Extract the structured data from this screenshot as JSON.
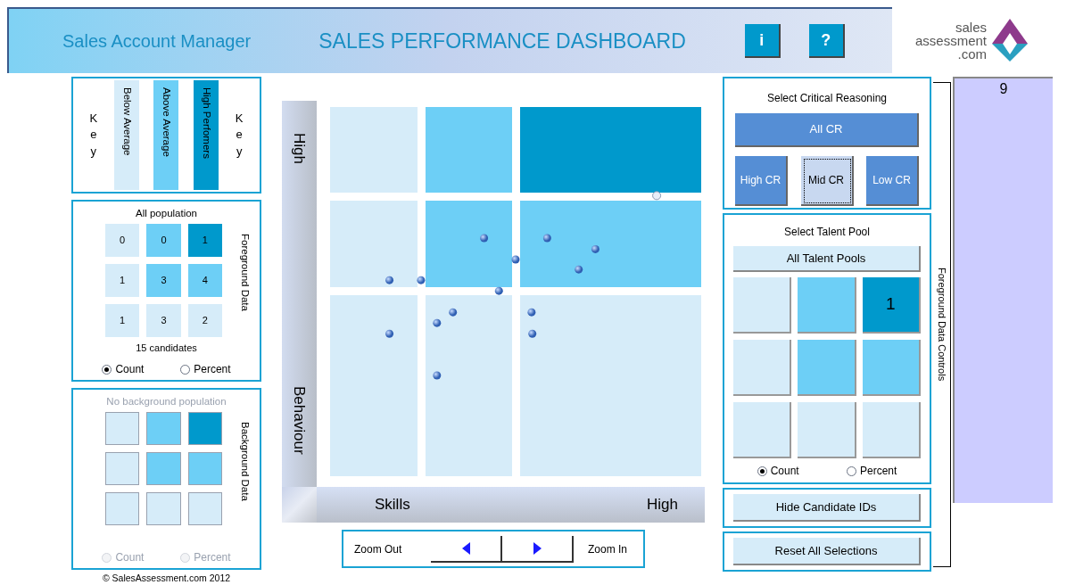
{
  "header": {
    "title": "Sales Account Manager",
    "dashboard_title": "SALES PERFORMANCE DASHBOARD",
    "buttons": [
      "i",
      "?"
    ],
    "logo": [
      "sales",
      "assessment",
      ".com"
    ]
  },
  "key": {
    "side_labels": [
      "Key",
      "Key"
    ],
    "items": [
      {
        "label": "Below Average",
        "color": "#d6ecf9"
      },
      {
        "label": "Above Average",
        "color": "#6dcff6"
      },
      {
        "label": "High Perfomers",
        "color": "#0099cc"
      }
    ]
  },
  "foreground": {
    "title": "All population",
    "side_label": "Foreground Data",
    "disabled": false,
    "cells": [
      {
        "value": "0",
        "color": "#d6ecf9"
      },
      {
        "value": "0",
        "color": "#6dcff6"
      },
      {
        "value": "1",
        "color": "#0099cc"
      },
      {
        "value": "1",
        "color": "#d6ecf9"
      },
      {
        "value": "3",
        "color": "#6dcff6"
      },
      {
        "value": "4",
        "color": "#6dcff6"
      },
      {
        "value": "1",
        "color": "#d6ecf9"
      },
      {
        "value": "3",
        "color": "#d6ecf9"
      },
      {
        "value": "2",
        "color": "#d6ecf9"
      }
    ],
    "summary": "15 candidates",
    "options": [
      {
        "label": "Count",
        "selected": true
      },
      {
        "label": "Percent",
        "selected": false
      }
    ]
  },
  "background": {
    "title": "No background population",
    "side_label": "Background Data",
    "disabled": true,
    "cells": [
      {
        "color": "#d6ecf9"
      },
      {
        "color": "#6dcff6"
      },
      {
        "color": "#0099cc"
      },
      {
        "color": "#d6ecf9"
      },
      {
        "color": "#6dcff6"
      },
      {
        "color": "#6dcff6"
      },
      {
        "color": "#d6ecf9"
      },
      {
        "color": "#d6ecf9"
      },
      {
        "color": "#d6ecf9"
      }
    ],
    "options": [
      {
        "label": "Count",
        "selected": false
      },
      {
        "label": "Percent",
        "selected": false
      }
    ]
  },
  "copyright": "© SalesAssessment.com 2012",
  "chart": {
    "y_labels": [
      "High",
      "Behaviour"
    ],
    "x_labels": [
      "Skills",
      "High"
    ],
    "cells": [
      {
        "color": "#d6ecf9"
      },
      {
        "color": "#6dcff6"
      },
      {
        "color": "#0099cc"
      },
      {
        "color": "#d6ecf9"
      },
      {
        "color": "#6dcff6"
      },
      {
        "color": "#6dcff6"
      },
      {
        "color": "#d6ecf9"
      },
      {
        "color": "#d6ecf9"
      },
      {
        "color": "#d6ecf9"
      }
    ]
  },
  "zoom": {
    "out_label": "Zoom Out",
    "in_label": "Zoom In"
  },
  "critical_reasoning": {
    "title": "Select Critical Reasoning",
    "all": {
      "label": "All CR",
      "selected": false
    },
    "buttons": [
      {
        "label": "High CR",
        "selected": false
      },
      {
        "label": "Mid CR",
        "selected": true
      },
      {
        "label": "Low CR",
        "selected": false
      }
    ]
  },
  "talent_pool": {
    "title": "Select Talent Pool",
    "all_button": "All Talent Pools",
    "cells": [
      {
        "color": "#d6ecf9"
      },
      {
        "color": "#6dcff6"
      },
      {
        "color": "#0099cc",
        "value": "1"
      },
      {
        "color": "#d6ecf9"
      },
      {
        "color": "#6dcff6"
      },
      {
        "color": "#6dcff6"
      },
      {
        "color": "#d6ecf9"
      },
      {
        "color": "#d6ecf9"
      },
      {
        "color": "#d6ecf9"
      }
    ],
    "options": [
      {
        "label": "Count",
        "selected": true
      },
      {
        "label": "Percent",
        "selected": false
      }
    ]
  },
  "actions": [
    "Hide Candidate IDs",
    "Reset All Selections"
  ],
  "side_label": "Foreground Data Controls",
  "count_column": {
    "value": "9"
  }
}
